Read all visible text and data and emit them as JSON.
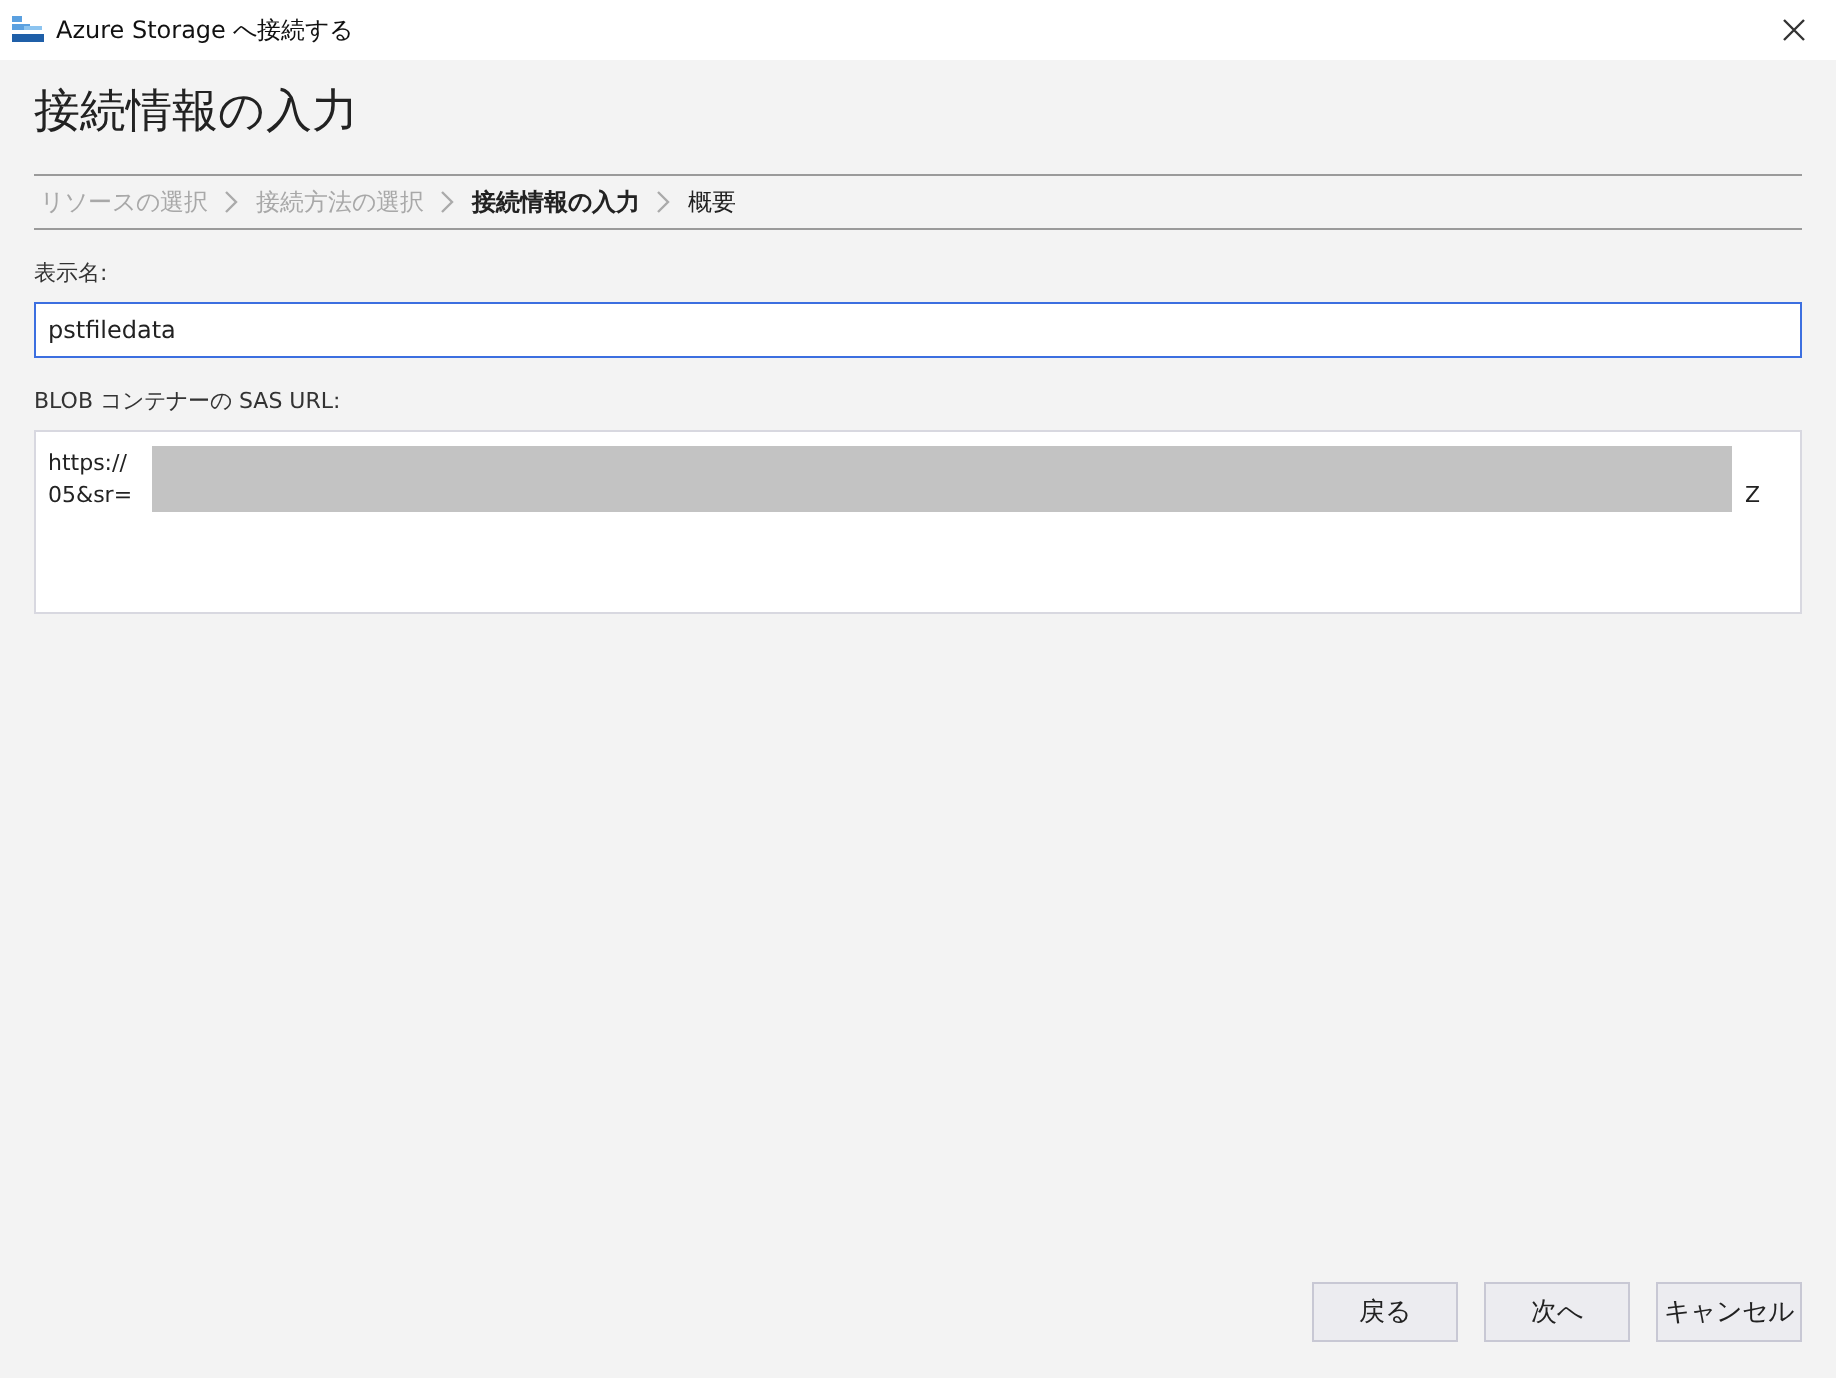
{
  "window": {
    "title": "Azure Storage へ接続する"
  },
  "heading": "接続情報の入力",
  "steps": [
    {
      "label": "リソースの選択",
      "completed": true,
      "selected": false
    },
    {
      "label": "接続方法の選択",
      "completed": true,
      "selected": false
    },
    {
      "label": "接続情報の入力",
      "completed": false,
      "selected": true
    },
    {
      "label": "概要",
      "completed": false,
      "selected": false
    }
  ],
  "display_name": {
    "label": "表示名:",
    "value": "pstfiledata",
    "focused": true
  },
  "sas_url": {
    "label": "BLOB コンテナーの SAS URL:",
    "lines": [
      "https://",
      "05&sr="
    ],
    "tail": "Z",
    "redacted": true
  },
  "buttons": [
    "戻る",
    "次へ",
    "キャンセル"
  ]
}
